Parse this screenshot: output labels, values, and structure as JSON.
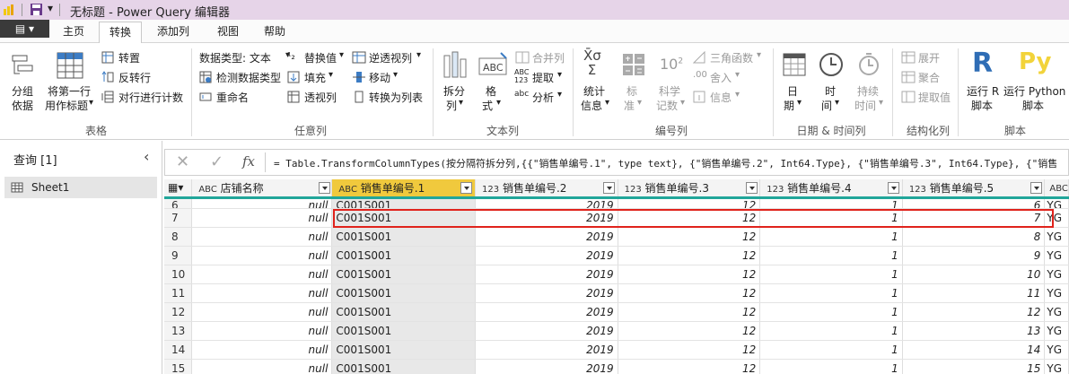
{
  "window": {
    "title": "无标题 - Power Query 编辑器",
    "title_bar_color": "#e6d4e8"
  },
  "tabs": {
    "file_label": "",
    "items": [
      {
        "label": "主页"
      },
      {
        "label": "转换"
      },
      {
        "label": "添加列"
      },
      {
        "label": "视图"
      },
      {
        "label": "帮助"
      }
    ],
    "active": "转换"
  },
  "ribbon": {
    "table_group": {
      "label": "表格",
      "group_by": "分组\n依据",
      "group_by_1": "分组",
      "group_by_2": "依据",
      "first_row_1": "将第一行",
      "first_row_2": "用作标题",
      "transpose": "转置",
      "reverse_rows": "反转行",
      "count_rows": "对行进行计数"
    },
    "any_column_group": {
      "label": "任意列",
      "data_type": "数据类型: 文本",
      "detect_type": "检测数据类型",
      "rename": "重命名",
      "replace_values": "替换值",
      "fill": "填充",
      "pivot_column": "透视列",
      "unpivot": "逆透视列",
      "move": "移动",
      "to_list": "转换为列表"
    },
    "text_column_group": {
      "label": "文本列",
      "split_1": "拆分",
      "split_2": "列",
      "format_1": "格",
      "format_2": "式",
      "merge_columns": "合并列",
      "extract": "提取",
      "parse": "分析"
    },
    "number_column_group": {
      "label": "编号列",
      "statistics_1": "统计",
      "statistics_2": "信息",
      "standard_1": "标",
      "standard_2": "准",
      "scientific_1": "科学",
      "scientific_2": "记数",
      "trig": "三角函数",
      "rounding": "舍入",
      "information": "信息"
    },
    "datetime_group": {
      "label": "日期 & 时间列",
      "date_1": "日",
      "date_2": "期",
      "time_1": "时",
      "time_2": "间",
      "duration_1": "持续",
      "duration_2": "时间"
    },
    "structured_group": {
      "label": "结构化列",
      "expand": "展开",
      "aggregate": "聚合",
      "extract_values": "提取值"
    },
    "script_group": {
      "label": "脚本",
      "run_r_1": "运行 R",
      "run_r_2": "脚本",
      "run_python_1": "运行 Python",
      "run_python_2": "脚本"
    }
  },
  "queries_pane": {
    "title": "查询 [1]",
    "items": [
      {
        "label": "Sheet1"
      }
    ]
  },
  "formula_bar": {
    "fx": "fx",
    "formula": "= Table.TransformColumnTypes(按分隔符拆分列,{{\"销售单编号.1\", type text}, {\"销售单编号.2\", Int64.Type}, {\"销售单编号.3\", Int64.Type}, {\"销售"
  },
  "grid": {
    "columns": [
      {
        "type": "ABC",
        "name": "店铺名称"
      },
      {
        "type": "ABC",
        "name": "销售单编号.1"
      },
      {
        "type": "123",
        "name": "销售单编号.2"
      },
      {
        "type": "123",
        "name": "销售单编号.3"
      },
      {
        "type": "123",
        "name": "销售单编号.4"
      },
      {
        "type": "123",
        "name": "销售单编号.5"
      },
      {
        "type": "ABC",
        "name": ""
      }
    ],
    "rows": [
      {
        "n": "6",
        "c1": "null",
        "c2": "C001S001",
        "c3": "2019",
        "c4": "12",
        "c5": "1",
        "c6": "6",
        "c7": "YG"
      },
      {
        "n": "7",
        "c1": "null",
        "c2": "C001S001",
        "c3": "2019",
        "c4": "12",
        "c5": "1",
        "c6": "7",
        "c7": "YG"
      },
      {
        "n": "8",
        "c1": "null",
        "c2": "C001S001",
        "c3": "2019",
        "c4": "12",
        "c5": "1",
        "c6": "8",
        "c7": "YG"
      },
      {
        "n": "9",
        "c1": "null",
        "c2": "C001S001",
        "c3": "2019",
        "c4": "12",
        "c5": "1",
        "c6": "9",
        "c7": "YG"
      },
      {
        "n": "10",
        "c1": "null",
        "c2": "C001S001",
        "c3": "2019",
        "c4": "12",
        "c5": "1",
        "c6": "10",
        "c7": "YG"
      },
      {
        "n": "11",
        "c1": "null",
        "c2": "C001S001",
        "c3": "2019",
        "c4": "12",
        "c5": "1",
        "c6": "11",
        "c7": "YG"
      },
      {
        "n": "12",
        "c1": "null",
        "c2": "C001S001",
        "c3": "2019",
        "c4": "12",
        "c5": "1",
        "c6": "12",
        "c7": "YG"
      },
      {
        "n": "13",
        "c1": "null",
        "c2": "C001S001",
        "c3": "2019",
        "c4": "12",
        "c5": "1",
        "c6": "13",
        "c7": "YG"
      },
      {
        "n": "14",
        "c1": "null",
        "c2": "C001S001",
        "c3": "2019",
        "c4": "12",
        "c5": "1",
        "c6": "14",
        "c7": "YG"
      },
      {
        "n": "15",
        "c1": "null",
        "c2": "C001S001",
        "c3": "2019",
        "c4": "12",
        "c5": "1",
        "c6": "15",
        "c7": "YG"
      }
    ],
    "selected_column": "销售单编号.1",
    "highlighted_row": "7",
    "accent_color": "#21a69a",
    "highlight_color": "#e0231c"
  }
}
